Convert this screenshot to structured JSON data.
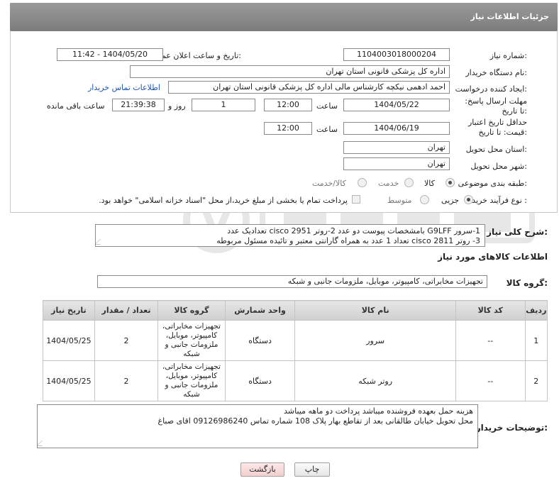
{
  "header": {
    "title": "جزئیات اطلاعات نیاز"
  },
  "fields": {
    "need_number_label": "شماره نیاز:",
    "need_number": "1104003018000204",
    "announce_label": "تاریخ و ساعت اعلان عمومی:",
    "announce_value": "1404/05/20 - 11:42",
    "buyer_org_label": "نام دستگاه خریدار:",
    "buyer_org": "اداره کل پزشکی قانونی استان تهران",
    "requester_label": "ایجاد کننده درخواست:",
    "requester": "احمد ادهمی نیکچه کارشناس مالی اداره کل پزشکی قانونی استان تهران",
    "buyer_contact_link": "اطلاعات تماس خریدار",
    "deadline_label": "مهلت ارسال پاسخ: تا تاریخ:",
    "deadline_date": "1404/05/22",
    "time_label": "ساعت",
    "deadline_time": "12:00",
    "days_value": "1",
    "days_label": "روز و",
    "remaining_time": "21:39:38",
    "remaining_label": "ساعت باقی مانده",
    "validity_label": "حداقل تاریخ اعتبار قیمت: تا تاریخ:",
    "validity_date": "1404/06/19",
    "validity_time": "12:00",
    "province_label": "استان محل تحویل:",
    "province": "تهران",
    "city_label": "شهر محل تحویل:",
    "city": "تهران",
    "category_label": "طبقه بندی موضوعی:",
    "category_options": [
      "کالا",
      "خدمت",
      "کالا/خدمت"
    ],
    "process_label": "نوع فرآیند خرید :",
    "process_options": [
      "جزیی",
      "متوسط"
    ],
    "payment_note": "پرداخت تمام یا بخشی از مبلغ خرید،از محل \"اسناد خزانه اسلامی\" خواهد بود."
  },
  "summary": {
    "label": "شرح کلی نیاز:",
    "line1": "1-سرور G9LFF  بامشخصات پیوست دو عدد    2-روتر cisco 2951 تعدادیک عدد",
    "line2": "3- روتر cisco 2811 تعداد 1 عدد به همراه گارانتی معتبر و تائیده مسئول مربوطه"
  },
  "goods": {
    "section_title": "اطلاعات کالاهای مورد نیاز",
    "group_label": "گروه کالا:",
    "group_value": "تجهیزات مخابراتی، کامپیوتر، موبایل، ملزومات جانبی و شبکه",
    "columns": [
      "ردیف",
      "کد کالا",
      "نام کالا",
      "واحد شمارش",
      "گروه کالا",
      "تعداد / مقدار",
      "تاریخ نیاز"
    ],
    "rows": [
      {
        "row": "1",
        "code": "--",
        "name": "سرور",
        "unit": "دستگاه",
        "group": "تجهیزات مخابراتی، کامپیوتر، موبایل، ملزومات جانبی و شبکه",
        "qty": "2",
        "date": "1404/05/25"
      },
      {
        "row": "2",
        "code": "--",
        "name": "روتر شبکه",
        "unit": "دستگاه",
        "group": "تجهیزات مخابراتی، کامپیوتر، موبایل، ملزومات جانبی و شبکه",
        "qty": "2",
        "date": "1404/05/25"
      }
    ]
  },
  "buyer_notes": {
    "label": "توضیحات خریدار:",
    "line1": "هزینه حمل بعهده فروشنده میباشد پرداخت دو ماهه میباشد",
    "line2": "محل تحویل خیابان طالقانی بعد از تقاطع بهار پلاک 108 شماره تماس 09126986240 اقای صباغ"
  },
  "buttons": {
    "print": "چاپ",
    "back": "بازگشت"
  },
  "colors": {
    "header": "#8a8a8a",
    "link": "#1a56b8",
    "back_button": "#f9d9d9"
  }
}
